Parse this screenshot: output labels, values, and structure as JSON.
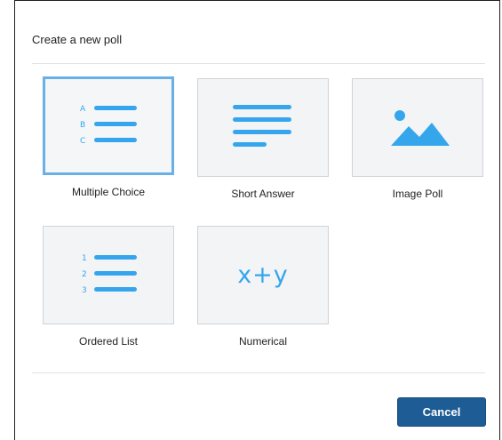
{
  "dialog": {
    "title": "Create a new poll",
    "cancel_label": "Cancel"
  },
  "poll_types": [
    {
      "label": "Multiple Choice",
      "icon": "multiple-choice-icon",
      "letters": [
        "A",
        "B",
        "C"
      ],
      "selected": true
    },
    {
      "label": "Short Answer",
      "icon": "short-answer-icon",
      "selected": false
    },
    {
      "label": "Image Poll",
      "icon": "image-icon",
      "selected": false
    },
    {
      "label": "Ordered List",
      "icon": "ordered-list-icon",
      "numbers": [
        "1",
        "2",
        "3"
      ],
      "selected": false
    },
    {
      "label": "Numerical",
      "icon": "numerical-icon",
      "symbol": "x+y",
      "selected": false
    }
  ],
  "colors": {
    "icon_blue": "#35a6ec",
    "selected_border": "#6ab0e6",
    "cancel_button": "#1d5c94"
  }
}
